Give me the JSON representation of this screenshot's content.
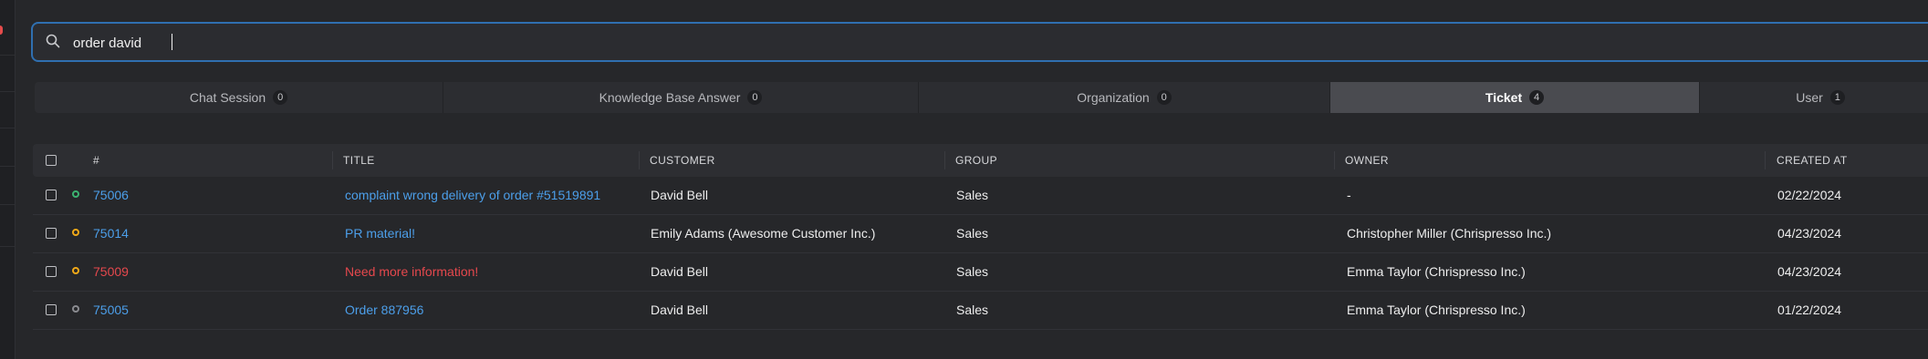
{
  "search": {
    "value": "order david",
    "placeholder": ""
  },
  "tabs": [
    {
      "label": "Chat Session",
      "count": "0",
      "active": false
    },
    {
      "label": "Knowledge Base Answer",
      "count": "0",
      "active": false
    },
    {
      "label": "Organization",
      "count": "0",
      "active": false
    },
    {
      "label": "Ticket",
      "count": "4",
      "active": true
    },
    {
      "label": "User",
      "count": "1",
      "active": false
    }
  ],
  "table": {
    "headers": {
      "number": "#",
      "title": "TITLE",
      "customer": "CUSTOMER",
      "group": "GROUP",
      "owner": "OWNER",
      "created_at": "CREATED AT"
    },
    "rows": [
      {
        "number": "75006",
        "title": "complaint wrong delivery of order #51519891",
        "customer": "David Bell",
        "group": "Sales",
        "owner": "-",
        "created_at": "02/22/2024",
        "status_color": "#3cb371",
        "escalated": false
      },
      {
        "number": "75014",
        "title": "PR material!",
        "customer": "Emily Adams (Awesome Customer Inc.)",
        "group": "Sales",
        "owner": "Christopher Miller (Chrispresso Inc.)",
        "created_at": "04/23/2024",
        "status_color": "#f0a818",
        "escalated": false
      },
      {
        "number": "75009",
        "title": "Need more information!",
        "customer": "David Bell",
        "group": "Sales",
        "owner": "Emma Taylor (Chrispresso Inc.)",
        "created_at": "04/23/2024",
        "status_color": "#f0a818",
        "escalated": true
      },
      {
        "number": "75005",
        "title": "Order 887956",
        "customer": "David Bell",
        "group": "Sales",
        "owner": "Emma Taylor (Chrispresso Inc.)",
        "created_at": "01/22/2024",
        "status_color": "#8a8b90",
        "escalated": false
      }
    ]
  },
  "colors": {
    "accent": "#2f6fb0",
    "link": "#4c9fea",
    "escalated": "#e5484d"
  }
}
